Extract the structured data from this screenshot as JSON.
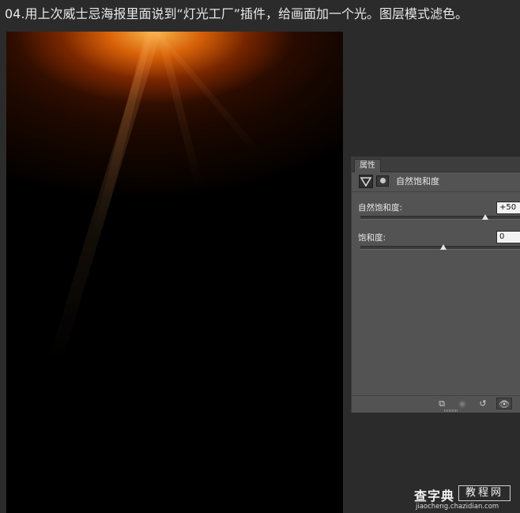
{
  "caption": "04.用上次威士忌海报里面说到“灯光工厂”插件，给画面加一个光。图层模式滤色。",
  "panel": {
    "tab_label": "属性",
    "title": "自然饱和度",
    "header_icons": [
      "vibrance-adjustment-icon",
      "layer-mask-icon"
    ],
    "rows": [
      {
        "label": "自然饱和度:",
        "value": "+50",
        "slider_value": 50,
        "slider_min": -100,
        "slider_max": 100
      },
      {
        "label": "饱和度:",
        "value": "0",
        "slider_value": 0,
        "slider_min": -100,
        "slider_max": 100
      }
    ],
    "footer_icons": [
      "clip-to-layer-icon",
      "view-previous-state-icon",
      "reset-icon",
      "visibility-eye-icon"
    ],
    "footer_glyphs": {
      "clip": "⧉",
      "prev": "◉",
      "reset": "↺",
      "eye": "👁"
    }
  },
  "watermark": {
    "logo": "查字典",
    "box_text": "教程网",
    "url": "jiaocheng.chazidian.com"
  },
  "colors": {
    "canvas_background": "#000000",
    "glow_core": "#ffbe50",
    "glow_mid": "#f06e0a",
    "panel_background": "#535353"
  }
}
